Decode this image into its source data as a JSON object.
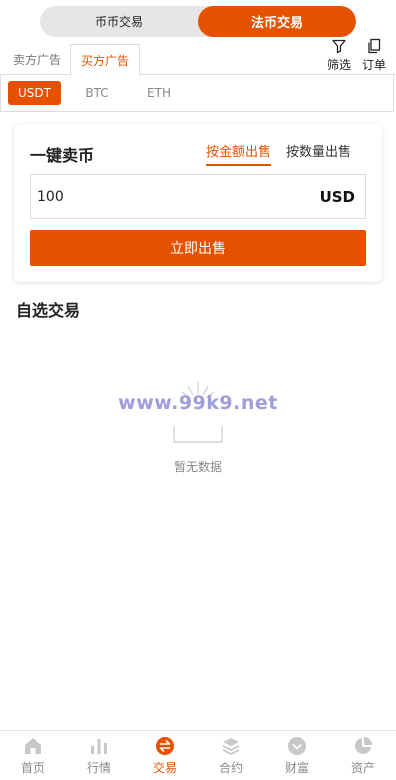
{
  "top_toggle": {
    "spot_label": "币币交易",
    "otc_label": "法币交易"
  },
  "ad_tabs": {
    "sell_ads": "卖方广告",
    "buy_ads": "买方广告"
  },
  "tools": {
    "filter_label": "筛选",
    "orders_label": "订单"
  },
  "coins": [
    "USDT",
    "BTC",
    "ETH"
  ],
  "quick_sell": {
    "title": "一键卖币",
    "mode_amount": "按金额出售",
    "mode_quantity": "按数量出售",
    "amount_value": "100",
    "currency": "USD",
    "button_label": "立即出售"
  },
  "section": {
    "title": "自选交易"
  },
  "empty": {
    "text": "暂无数据",
    "watermark": "www.99k9.net"
  },
  "nav": [
    "首页",
    "行情",
    "交易",
    "合约",
    "财富",
    "资产"
  ],
  "colors": {
    "accent": "#e65100",
    "inactive_nav": "#888888"
  }
}
